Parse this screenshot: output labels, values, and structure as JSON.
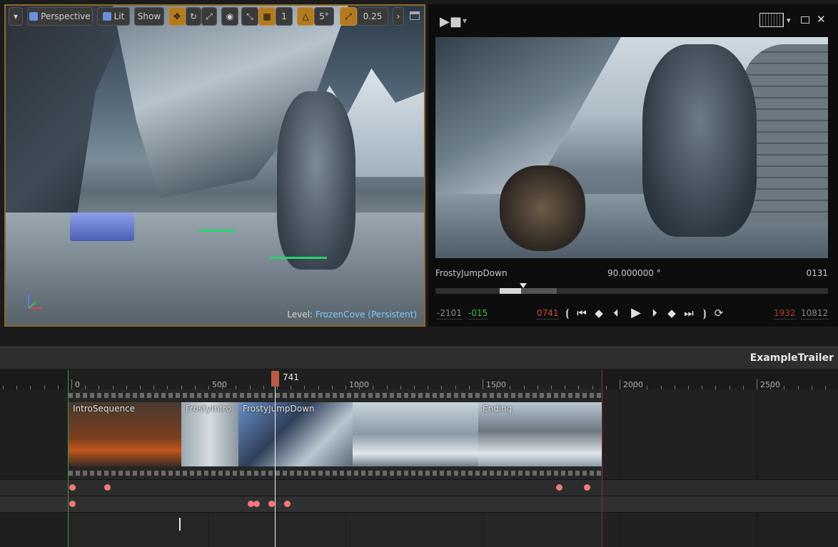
{
  "viewport": {
    "toolbar": {
      "perspective_label": "Perspective",
      "lit_label": "Lit",
      "show_label": "Show",
      "grid_snap_value": "1",
      "rotate_snap_value": "5°",
      "camera_speed_value": "0.25"
    },
    "level_label": "Level:",
    "level_value": "FrozenCove (Persistent)"
  },
  "cinematic": {
    "shot_name": "FrostyJumpDown",
    "fov": "90.000000 °",
    "frame_right": "0131",
    "timecodes": {
      "start_outer": "-2101",
      "start_inner": "-015",
      "current": "0741",
      "end_inner": "1932",
      "end_outer": "10812"
    }
  },
  "sequencer": {
    "title": "ExampleTrailer",
    "playhead_frame": "741",
    "ruler_labels": [
      "0",
      "500",
      "1000",
      "1500",
      "2000",
      "2500"
    ],
    "shots": [
      {
        "name": "IntroSequence"
      },
      {
        "name": "FrostyIntro"
      },
      {
        "name": "FrostyJumpDown"
      },
      {
        "name": ""
      },
      {
        "name": "Ending"
      }
    ]
  },
  "colors": {
    "viewport_border": "#8c6a2a",
    "keyframe": "#f07a7a",
    "playhead": "#b85a45",
    "level_value": "#7ecbff"
  }
}
